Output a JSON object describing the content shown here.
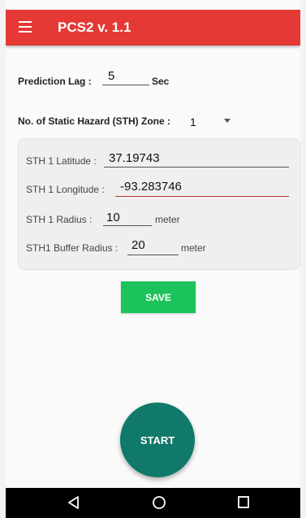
{
  "app": {
    "title": "PCS2 v. 1.1",
    "accent_color": "#e53935"
  },
  "prediction": {
    "label": "Prediction Lag :",
    "value": "5",
    "unit": "Sec"
  },
  "zones": {
    "label": "No. of Static Hazard (STH) Zone :",
    "selected": "1"
  },
  "sth": {
    "latitude_label": "STH 1 Latitude :",
    "latitude_value": "37.19743",
    "longitude_label": "STH 1  Longitude :",
    "longitude_value": "-93.283746",
    "radius_label": "STH 1  Radius :",
    "radius_value": "10",
    "radius_unit": "meter",
    "buffer_label": "STH1 Buffer Radius :",
    "buffer_value": "20",
    "buffer_unit": "meter"
  },
  "actions": {
    "save_label": "SAVE",
    "start_label": "START"
  },
  "icons": {
    "menu": "hamburger-menu-icon",
    "back": "back-triangle-icon",
    "home": "home-circle-icon",
    "recents": "recents-square-icon"
  }
}
